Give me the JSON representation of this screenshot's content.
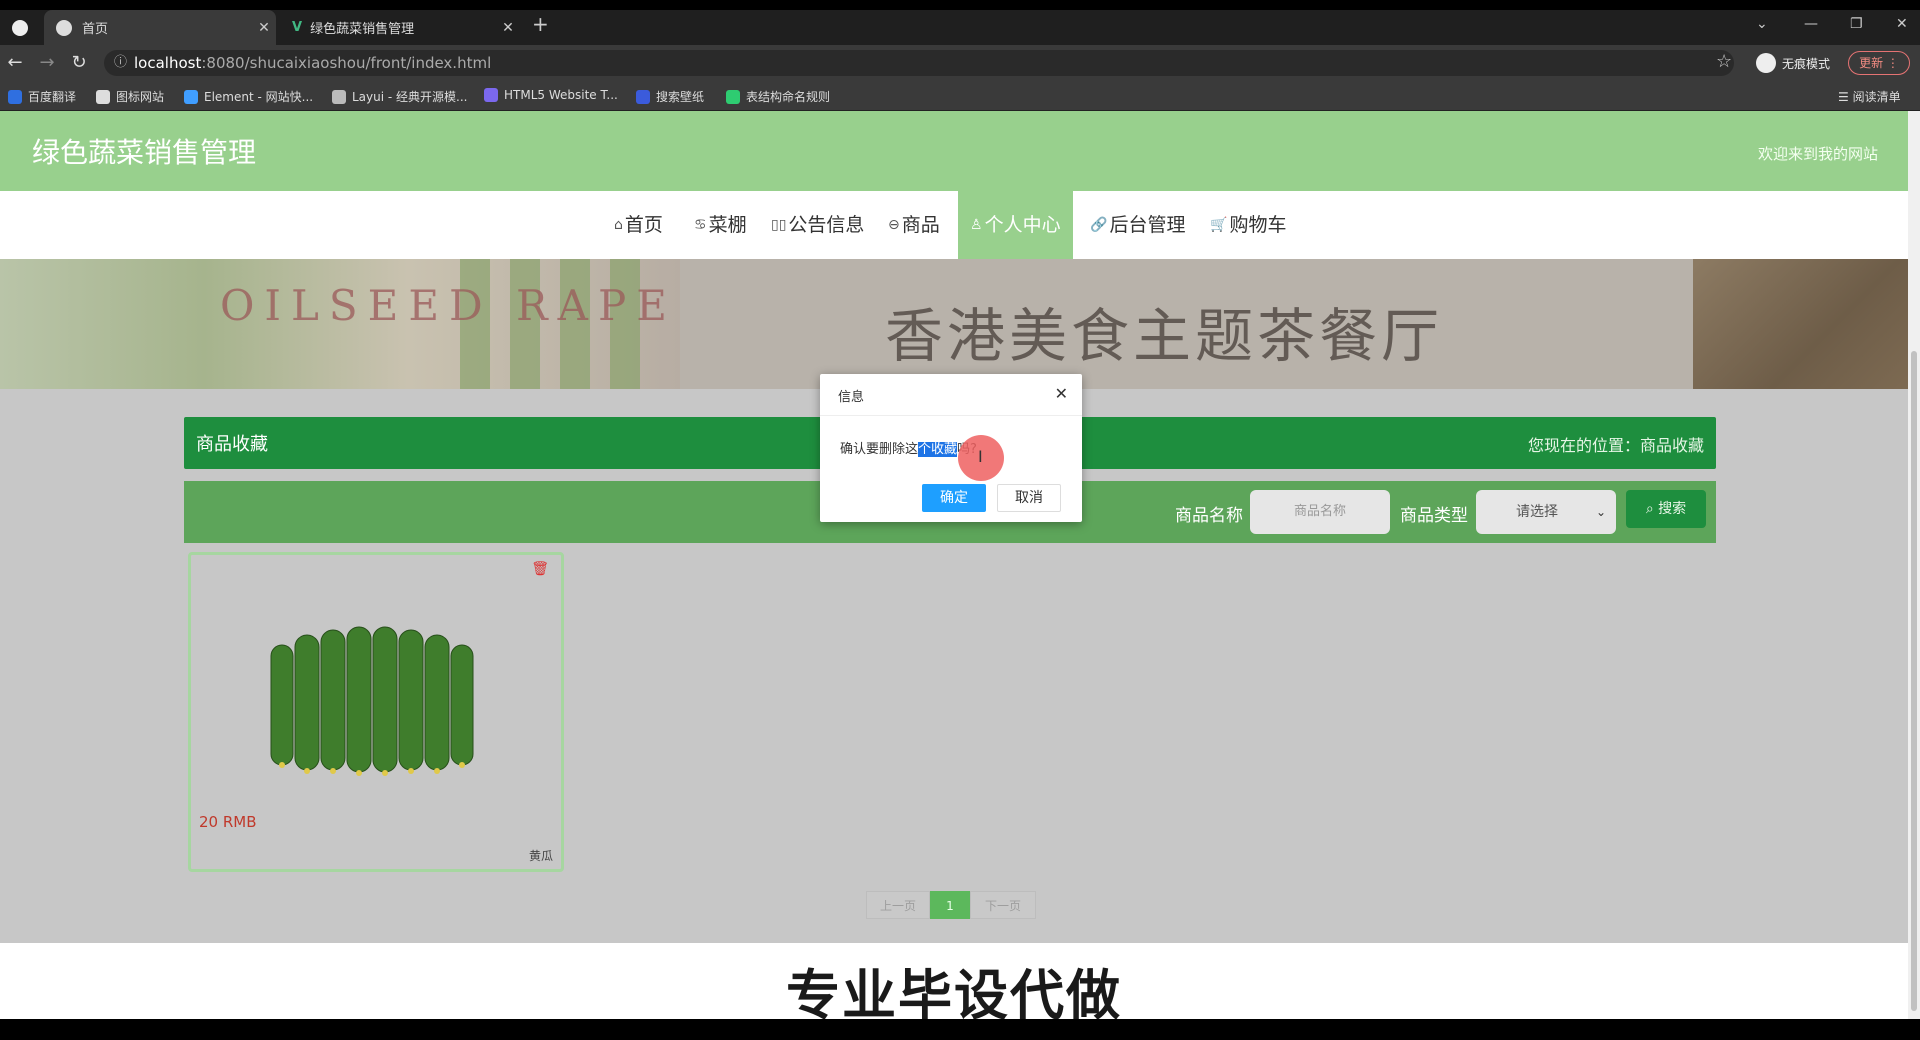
{
  "browser": {
    "tabs": [
      {
        "label": "首页",
        "active": true
      },
      {
        "label": "绿色蔬菜销售管理",
        "active": false
      }
    ],
    "new_tab": "+",
    "url_host": "localhost",
    "url_path": ":8080/shucaixiaoshou/front/index.html",
    "incognito_label": "无痕模式",
    "update_label": "更新",
    "bookmarks": [
      "百度翻译",
      "图标网站",
      "Element - 网站快...",
      "Layui - 经典开源模...",
      "HTML5 Website T...",
      "搜索壁纸",
      "表结构命名规则"
    ],
    "reading_list": "阅读清单"
  },
  "header": {
    "site_title": "绿色蔬菜销售管理",
    "welcome": "欢迎来到我的网站"
  },
  "nav": {
    "items": [
      {
        "icon": "⌂",
        "label": "首页"
      },
      {
        "icon": "♋",
        "label": "菜棚"
      },
      {
        "icon": "▯▯",
        "label": "公告信息"
      },
      {
        "icon": "⊖",
        "label": "商品"
      },
      {
        "icon": "♙",
        "label": "个人中心"
      },
      {
        "icon": "🔗",
        "label": "后台管理"
      },
      {
        "icon": "🛒",
        "label": "购物车"
      }
    ],
    "active_index": 4
  },
  "banner": {
    "text_en": "OILSEED RAPE",
    "text_cn": "香港美食主题茶餐厅"
  },
  "crumbbar": {
    "title": "商品收藏",
    "location": "您现在的位置：商品收藏"
  },
  "search": {
    "name_label": "商品名称",
    "name_placeholder": "商品名称",
    "type_label": "商品类型",
    "type_selected": "请选择",
    "search_button": "搜索"
  },
  "items": [
    {
      "price": "20 RMB",
      "name": "黄瓜"
    }
  ],
  "pager": {
    "prev": "上一页",
    "current": "1",
    "next": "下一页"
  },
  "footer": {
    "promo": "专业毕设代做"
  },
  "dialog": {
    "title": "信息",
    "message_prefix": "确认要删除这",
    "message_selected": "个收藏",
    "message_suffix": "吗?",
    "ok": "确定",
    "cancel": "取消"
  },
  "colors": {
    "header_green": "#98d08d",
    "bar_green": "#1e8e3e",
    "search_green": "#5da55a",
    "ok_blue": "#1e9fff"
  }
}
